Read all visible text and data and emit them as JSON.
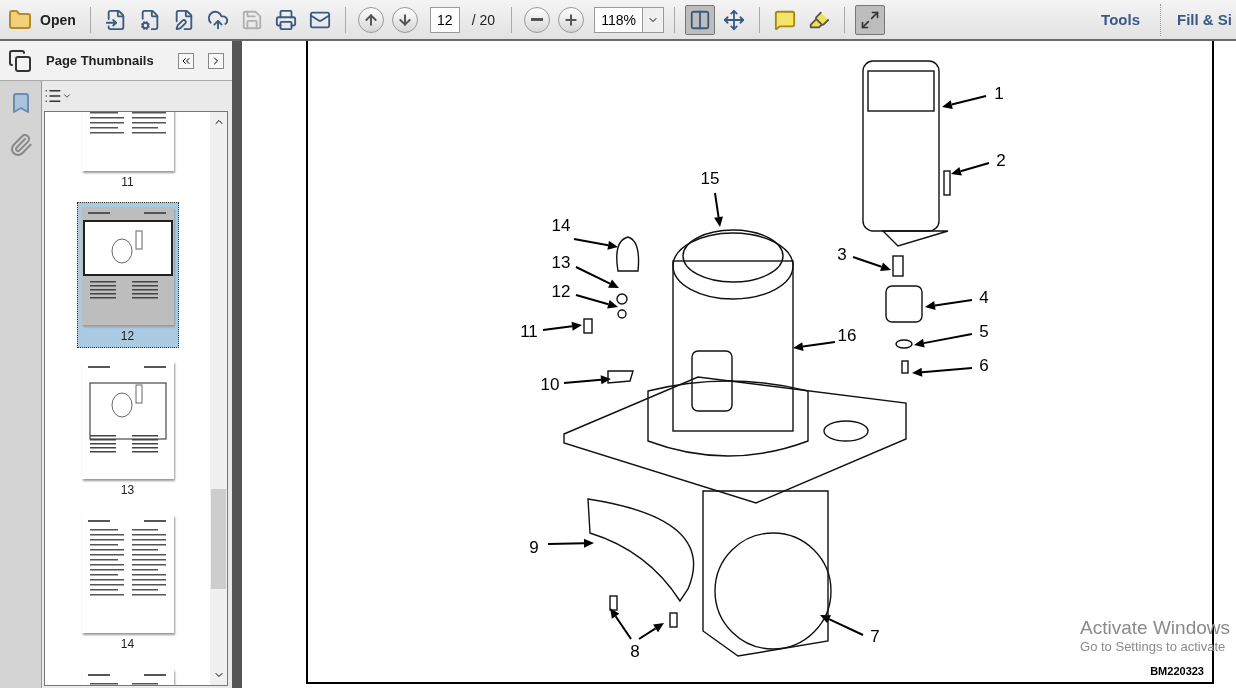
{
  "toolbar": {
    "open_label": "Open",
    "file_tools": [
      {
        "kind": "create",
        "disabled": false
      },
      {
        "kind": "convert",
        "disabled": false
      },
      {
        "kind": "edit",
        "disabled": false
      },
      {
        "kind": "upload",
        "disabled": false
      },
      {
        "kind": "save",
        "disabled": true
      },
      {
        "kind": "print",
        "disabled": false
      },
      {
        "kind": "email",
        "disabled": false
      }
    ],
    "current_page": "12",
    "page_total": "/ 20",
    "zoom": "118%",
    "view_modes": [
      {
        "kind": "fit-page",
        "selected": true
      },
      {
        "kind": "fit-width",
        "selected": false
      }
    ],
    "right_tabs": [
      "Tools",
      "Fill & Si"
    ]
  },
  "sidebar": {
    "title": "Page Thumbnails",
    "thumbnails": [
      {
        "label": "11",
        "selected": false,
        "kind": "text"
      },
      {
        "label": "12",
        "selected": true,
        "kind": "figure"
      },
      {
        "label": "13",
        "selected": false,
        "kind": "figure"
      },
      {
        "label": "14",
        "selected": false,
        "kind": "text"
      }
    ]
  },
  "document": {
    "callouts": [
      {
        "label": "1",
        "kind": "single"
      },
      {
        "label": "2",
        "kind": "single"
      },
      {
        "label": "15",
        "kind": "single"
      },
      {
        "label": "14",
        "kind": "single"
      },
      {
        "label": "3",
        "kind": "single"
      },
      {
        "label": "13",
        "kind": "single"
      },
      {
        "label": "12",
        "kind": "single"
      },
      {
        "label": "4",
        "kind": "single"
      },
      {
        "label": "11",
        "kind": "single"
      },
      {
        "label": "16",
        "kind": "single"
      },
      {
        "label": "5",
        "kind": "single"
      },
      {
        "label": "6",
        "kind": "single"
      },
      {
        "label": "10",
        "kind": "single"
      },
      {
        "label": "9",
        "kind": "single"
      },
      {
        "label": "7",
        "kind": "single"
      },
      {
        "label": "8",
        "kind": "double"
      }
    ],
    "figure_id": "BM220323"
  },
  "os_notice": {
    "title": "Activate Windows",
    "text": "Go to Settings to activate"
  }
}
